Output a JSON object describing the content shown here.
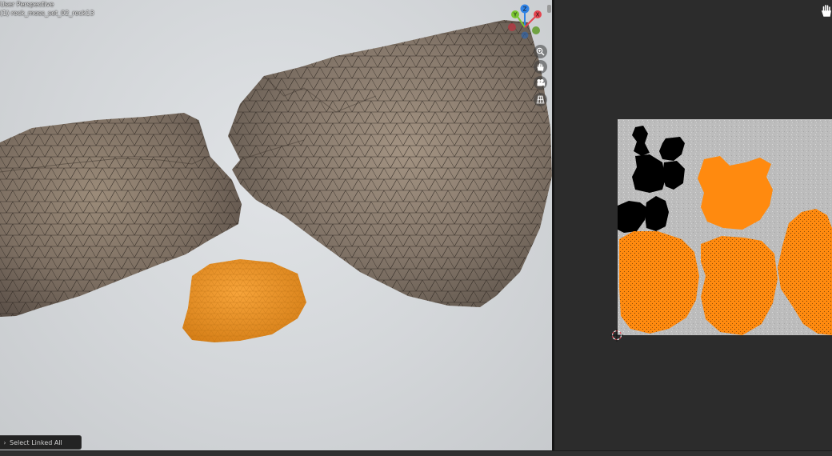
{
  "viewport": {
    "mode_label": "User Perspective",
    "object_label": "(1) rock_moss_set_02_rock13"
  },
  "gizmo": {
    "axes": [
      {
        "label": "Z",
        "color": "#2f83e6"
      },
      {
        "label": "Y",
        "color": "#7ac531"
      },
      {
        "label": "X",
        "color": "#e4444f"
      }
    ]
  },
  "operator_panel": {
    "label": "Select Linked All"
  },
  "colors": {
    "selection": "#f7911d",
    "uv_island_selected": "#ff8a0f",
    "uv_island_unselected": "#000000",
    "rock_base": "#8c7d6c"
  }
}
